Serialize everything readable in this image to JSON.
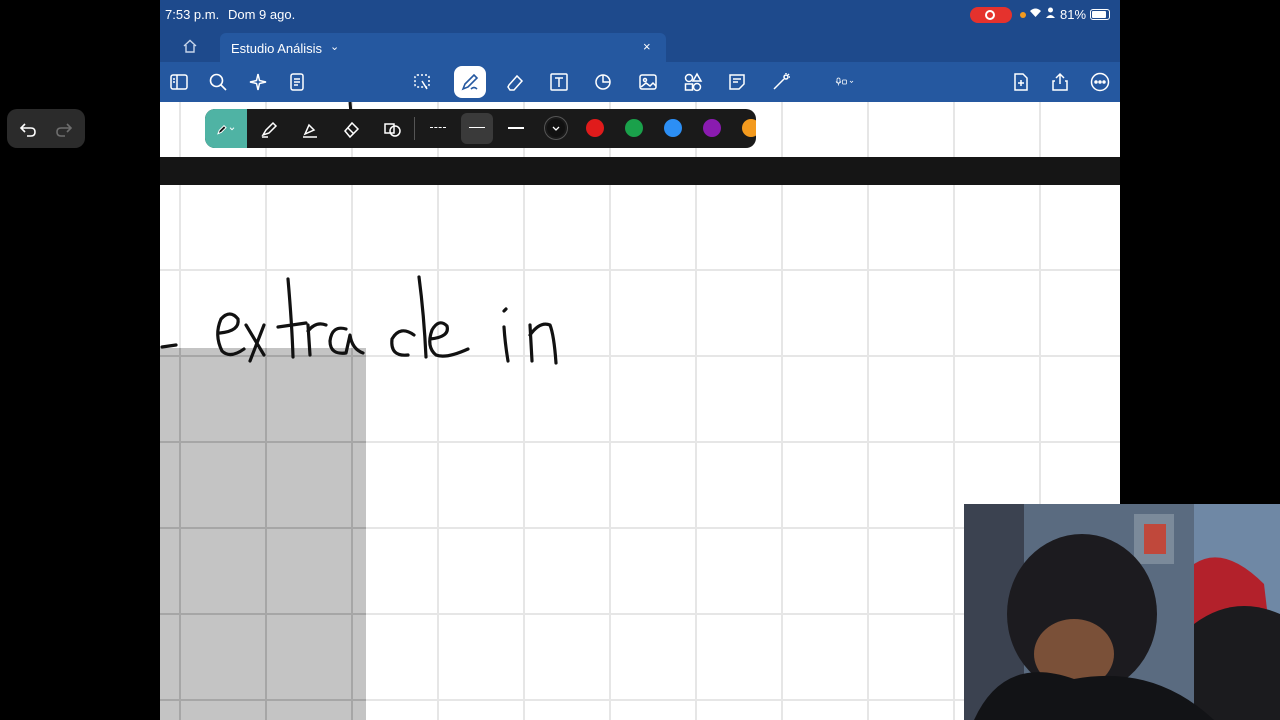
{
  "status_bar": {
    "time": "7:53 p.m.",
    "date": "Dom 9 ago.",
    "battery": "81%",
    "colors": {
      "record": "#e5322d",
      "orange_dot": "#f39a1e"
    }
  },
  "tab": {
    "title": "Estudio Análisis"
  },
  "toolbar": {
    "left_icons": [
      "sidebar-icon",
      "search-icon",
      "sparkle-icon",
      "notes-icon"
    ],
    "center_icons": [
      "lasso-icon",
      "pen-icon",
      "eraser-icon",
      "text-icon",
      "shapes-icon",
      "image-icon",
      "elements-icon",
      "sticky-note-icon",
      "laser-icon",
      "mic-icon"
    ],
    "right_icons": [
      "add-page-icon",
      "share-icon",
      "more-icon"
    ],
    "active": "pen-icon"
  },
  "drawing_pill": {
    "tools": [
      "pen-tool",
      "highlighter-tool",
      "fill-tool",
      "eraser-tool",
      "shape-tool"
    ],
    "line_styles": [
      "dashed",
      "medium",
      "thin"
    ],
    "colors": [
      "#111111",
      "#e01b1b",
      "#1aa14b",
      "#2c8ff5",
      "#8a1bb0",
      "#f39a1e"
    ],
    "selected_color": "#111111"
  },
  "canvas": {
    "handwriting": "extra de in",
    "highlight_color": "#c4c4c4"
  },
  "accent_colors": {
    "app_bar": "#1e4a8c",
    "toolbar": "#2558a0",
    "active_tool": "#4fb3a4"
  }
}
